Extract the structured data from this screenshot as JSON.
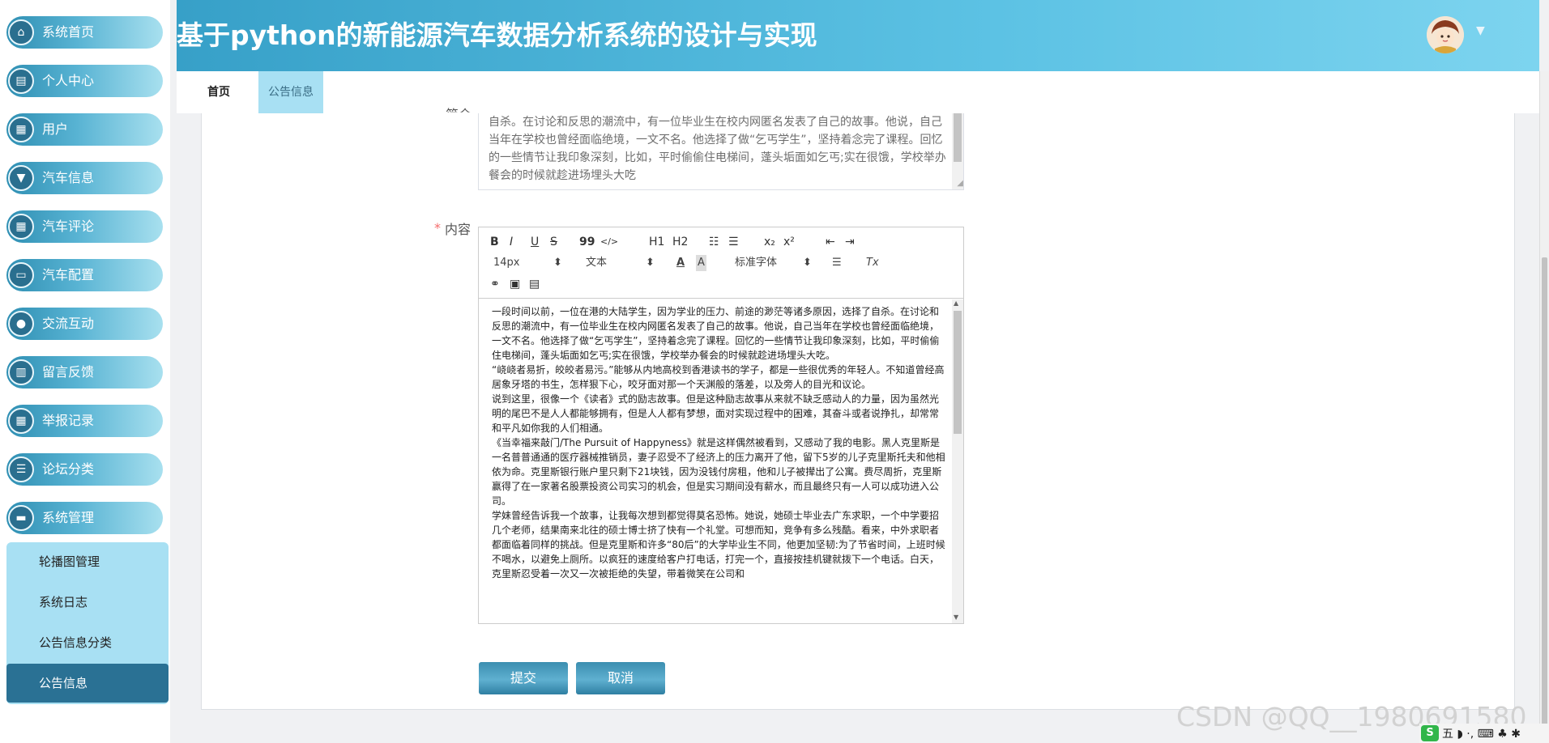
{
  "header": {
    "title": "基于python的新能源汽车数据分析系统的设计与实现"
  },
  "sidebar": {
    "items": [
      {
        "label": "系统首页",
        "icon": "home-icon",
        "glyph": "⌂"
      },
      {
        "label": "个人中心",
        "icon": "id-card-icon",
        "glyph": "▤"
      },
      {
        "label": "用户",
        "icon": "grid-icon",
        "glyph": "▦"
      },
      {
        "label": "汽车信息",
        "icon": "pin-icon",
        "glyph": "▼"
      },
      {
        "label": "汽车评论",
        "icon": "grid-icon",
        "glyph": "▦"
      },
      {
        "label": "汽车配置",
        "icon": "monitor-icon",
        "glyph": "▭"
      },
      {
        "label": "交流互动",
        "icon": "bulb-icon",
        "glyph": "●"
      },
      {
        "label": "留言反馈",
        "icon": "bar-chart-icon",
        "glyph": "▥"
      },
      {
        "label": "举报记录",
        "icon": "grid-icon",
        "glyph": "▦"
      },
      {
        "label": "论坛分类",
        "icon": "list-icon",
        "glyph": "☰"
      },
      {
        "label": "系统管理",
        "icon": "folder-icon",
        "glyph": "▬"
      }
    ],
    "submenu": [
      {
        "label": "轮播图管理"
      },
      {
        "label": "系统日志"
      },
      {
        "label": "公告信息分类"
      },
      {
        "label": "公告信息",
        "active": true
      }
    ]
  },
  "tabs": {
    "home": "首页",
    "notice": "公告信息"
  },
  "form": {
    "intro_label_fragment": "简介",
    "intro_text": "自杀。在讨论和反思的潮流中，有一位毕业生在校内网匿名发表了自己的故事。他说，自己当年在学校也曾经面临绝境，一文不名。他选择了做“乞丐学生”，坚持着念完了课程。回忆的一些情节让我印象深刻，比如，平时偷偷住电梯间，蓬头垢面如乞丐;实在很饿，学校举办餐会的时候就趁进场埋头大吃",
    "content_required": "*",
    "content_label": "内容",
    "toolbar": {
      "bold": "B",
      "italic": "I",
      "underline": "U",
      "strike": "S",
      "quote": "99",
      "code": "</>",
      "h1": "H1",
      "h2": "H2",
      "sub": "x₂",
      "sup": "x²",
      "size": "14px",
      "text_type": "文本",
      "font": "标准字体",
      "font_color": "A",
      "bg_color": "A",
      "clear_format": "Tx"
    },
    "paragraphs": [
      "一段时间以前，一位在港的大陆学生，因为学业的压力、前途的渺茫等诸多原因，选择了自杀。在讨论和反思的潮流中，有一位毕业生在校内网匿名发表了自己的故事。他说，自己当年在学校也曾经面临绝境，一文不名。他选择了做“乞丐学生”，坚持着念完了课程。回忆的一些情节让我印象深刻，比如，平时偷偷住电梯间，蓬头垢面如乞丐;实在很饿，学校举办餐会的时候就趁进场埋头大吃。",
      "“峣峣者易折，皎皎者易污。”能够从内地高校到香港读书的学子，都是一些很优秀的年轻人。不知道曾经高居象牙塔的书生，怎样狠下心，咬牙面对那一个天渊般的落差，以及旁人的目光和议论。",
      "说到这里，很像一个《读者》式的励志故事。但是这种励志故事从来就不缺乏感动人的力量，因为虽然光明的尾巴不是人人都能够拥有，但是人人都有梦想，面对实现过程中的困难，其奋斗或者说挣扎，却常常和平凡如你我的人们相通。",
      "《当幸福来敲门/The Pursuit of Happyness》就是这样偶然被看到，又感动了我的电影。黑人克里斯是一名普普通通的医疗器械推销员，妻子忍受不了经济上的压力离开了他，留下5岁的儿子克里斯托夫和他相依为命。克里斯银行账户里只剩下21块钱，因为没钱付房租，他和儿子被撵出了公寓。费尽周折，克里斯赢得了在一家著名股票投资公司实习的机会，但是实习期间没有薪水，而且最终只有一人可以成功进入公司。",
      "学妹曾经告诉我一个故事，让我每次想到都觉得莫名恐怖。她说，她硕士毕业去广东求职，一个中学要招几个老师，结果南来北往的硕士博士挤了快有一个礼堂。可想而知，竞争有多么残酷。看来，中外求职者都面临着同样的挑战。但是克里斯和许多“80后”的大学毕业生不同，他更加坚韧:为了节省时间，上班时候不喝水，以避免上厕所。以疯狂的速度给客户打电话，打完一个，直接按挂机键就拨下一个电话。白天，克里斯忍受着一次又一次被拒绝的失望，带着微笑在公司和"
    ]
  },
  "buttons": {
    "submit": "提交",
    "cancel": "取消"
  },
  "watermark": "CSDN @QQ__1980691580",
  "tray": {
    "logo": "S",
    "text": "五 ◗ ·, ⌨ ♣ ✱"
  }
}
